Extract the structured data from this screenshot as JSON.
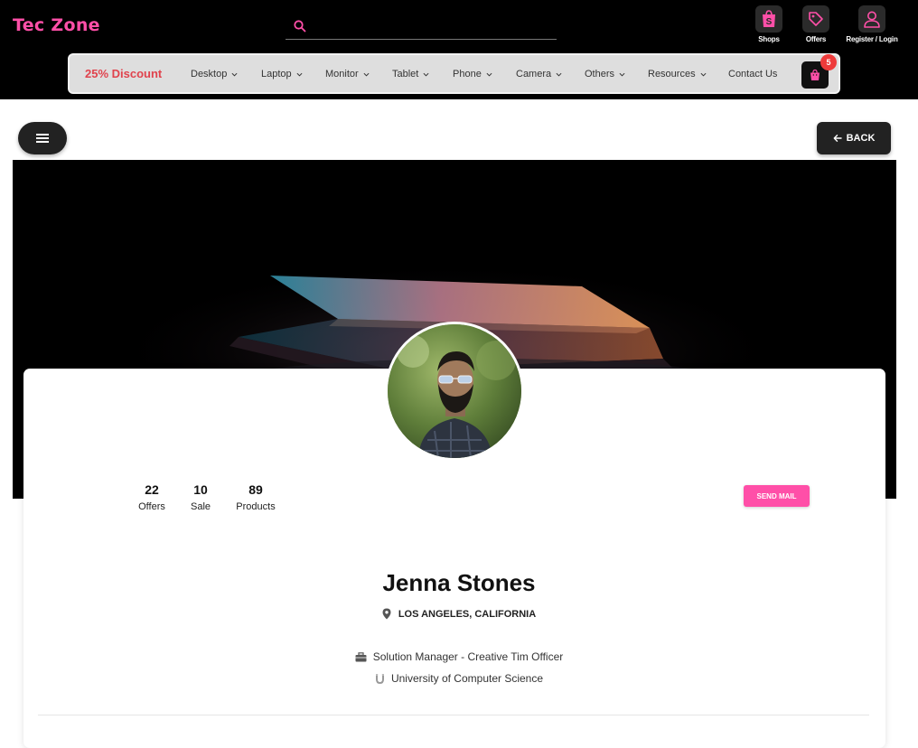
{
  "header": {
    "logo": "Tec Zone",
    "search": {
      "value": "",
      "placeholder": ""
    },
    "quick_links": [
      {
        "label": "Shops",
        "icon": "shopify-bag-icon"
      },
      {
        "label": "Offers",
        "icon": "tag-icon"
      },
      {
        "label": "Register / Login",
        "icon": "user-icon"
      }
    ]
  },
  "nav": {
    "discount": "25% Discount",
    "items": [
      "Desktop",
      "Laptop",
      "Monitor",
      "Tablet",
      "Phone",
      "Camera",
      "Others",
      "Resources",
      "Contact Us"
    ],
    "cart_count": "5",
    "cart_icon": "shopping-bag-icon"
  },
  "actions": {
    "menu_icon": "hamburger-icon",
    "back_label": "BACK",
    "back_icon": "arrow-left-icon"
  },
  "profile": {
    "stats": [
      {
        "value": "22",
        "label": "Offers"
      },
      {
        "value": "10",
        "label": "Sale"
      },
      {
        "value": "89",
        "label": "Products"
      }
    ],
    "send_mail_label": "SEND MAIL",
    "name": "Jenna Stones",
    "location": "LOS ANGELES, CALIFORNIA",
    "job": "Solution Manager - Creative Tim Officer",
    "education": "University of Computer Science"
  },
  "colors": {
    "brand_pink": "#ff4fa8",
    "discount_red": "#e0434d",
    "badge_red": "#ee3b3b"
  }
}
